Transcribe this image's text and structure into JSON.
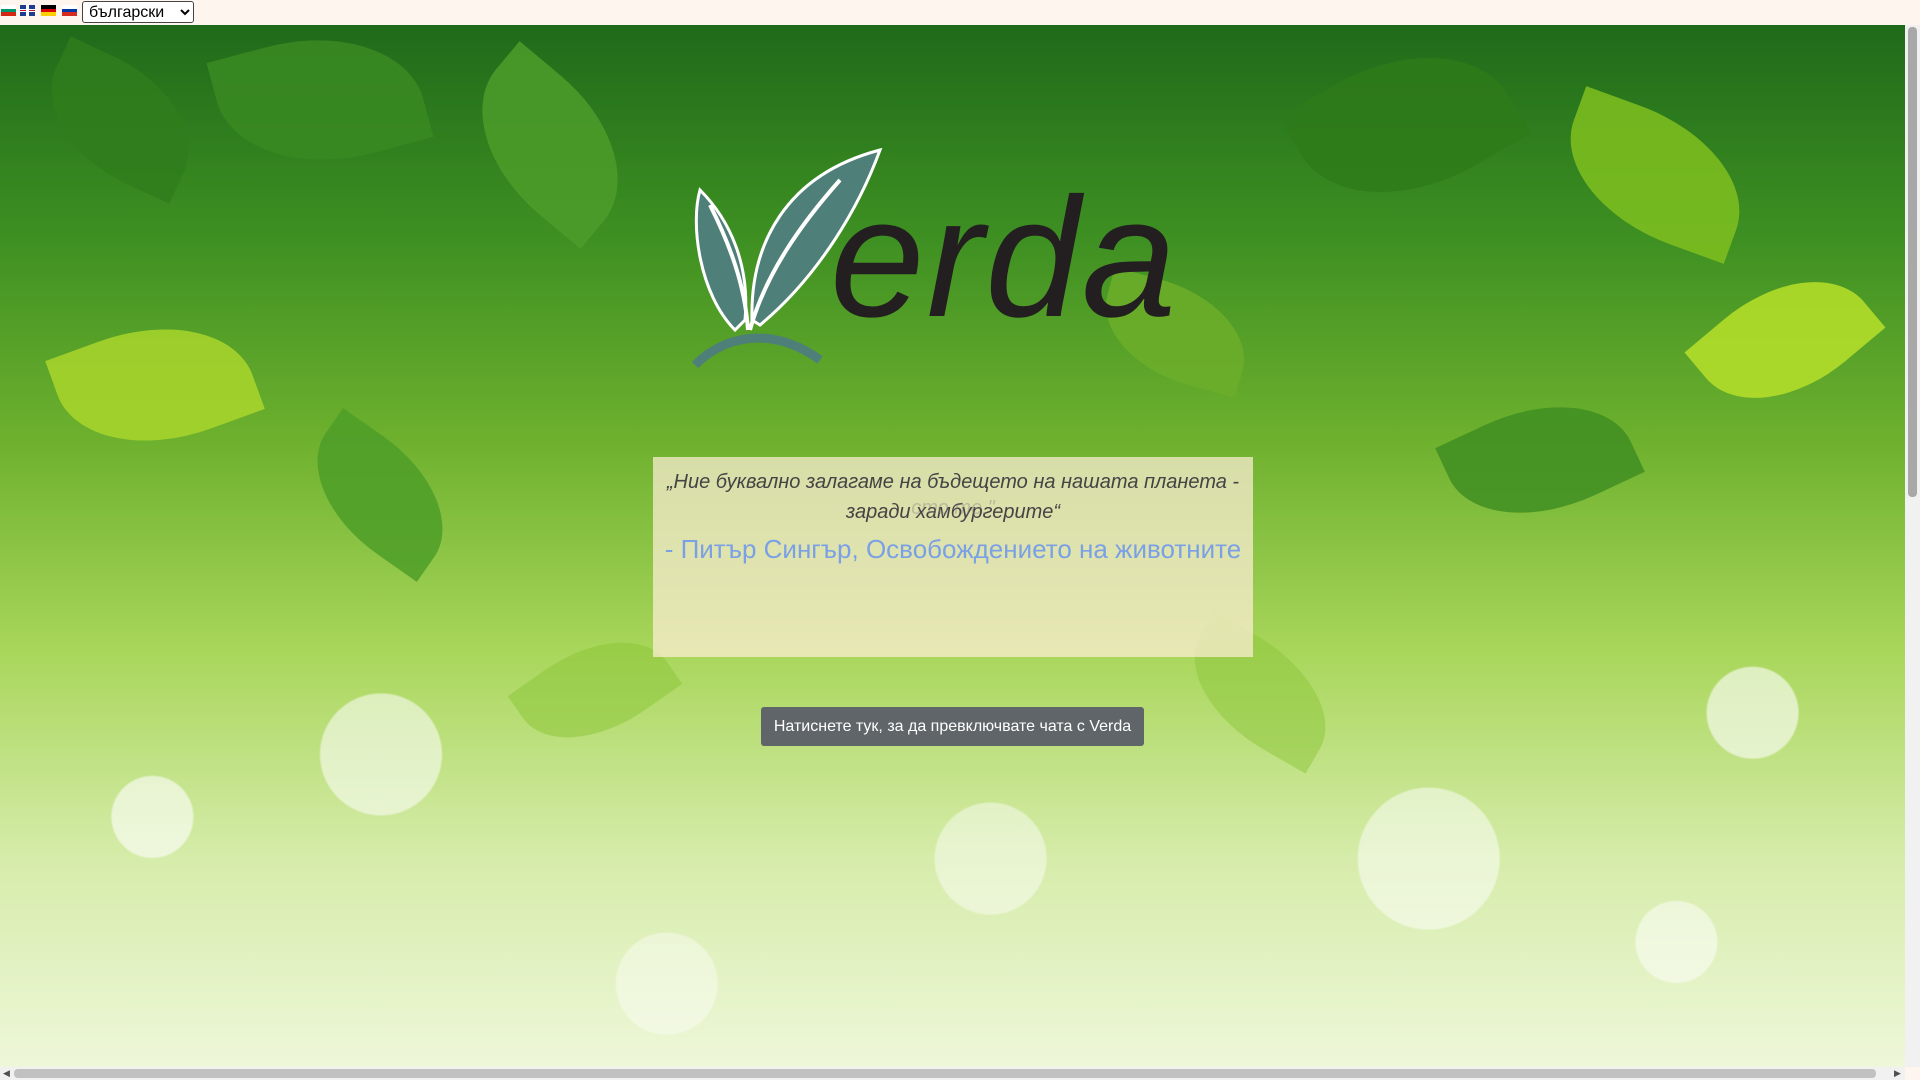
{
  "language_bar": {
    "flags": [
      {
        "name": "bulgarian-flag-icon",
        "colors": [
          "#ffffff",
          "#00966e",
          "#d62612"
        ]
      },
      {
        "name": "english-flag-icon",
        "colors": [
          "#1f3c8f",
          "#ffffff",
          "#c8102e"
        ]
      },
      {
        "name": "german-flag-icon",
        "colors": [
          "#000000",
          "#dd0000",
          "#ffce00"
        ]
      },
      {
        "name": "russian-flag-icon",
        "colors": [
          "#ffffff",
          "#0039a6",
          "#d52b1e"
        ]
      }
    ],
    "selected_language": "български"
  },
  "logo": {
    "text": "erda",
    "leaf_color": "#4e7f78"
  },
  "quote": {
    "text": "„Ние буквално залагаме на бъдещето на нашата планета - заради хамбургерите“",
    "ghost_text": "сто                                   те.\"",
    "author": "- Питър Сингър, Освобождението на животните"
  },
  "chat_button": {
    "label": "Натиснете тук, за да превключвате чата с Verda"
  },
  "colors": {
    "accent_author": "#7aa0e6",
    "button_bg": "#5f6569"
  }
}
